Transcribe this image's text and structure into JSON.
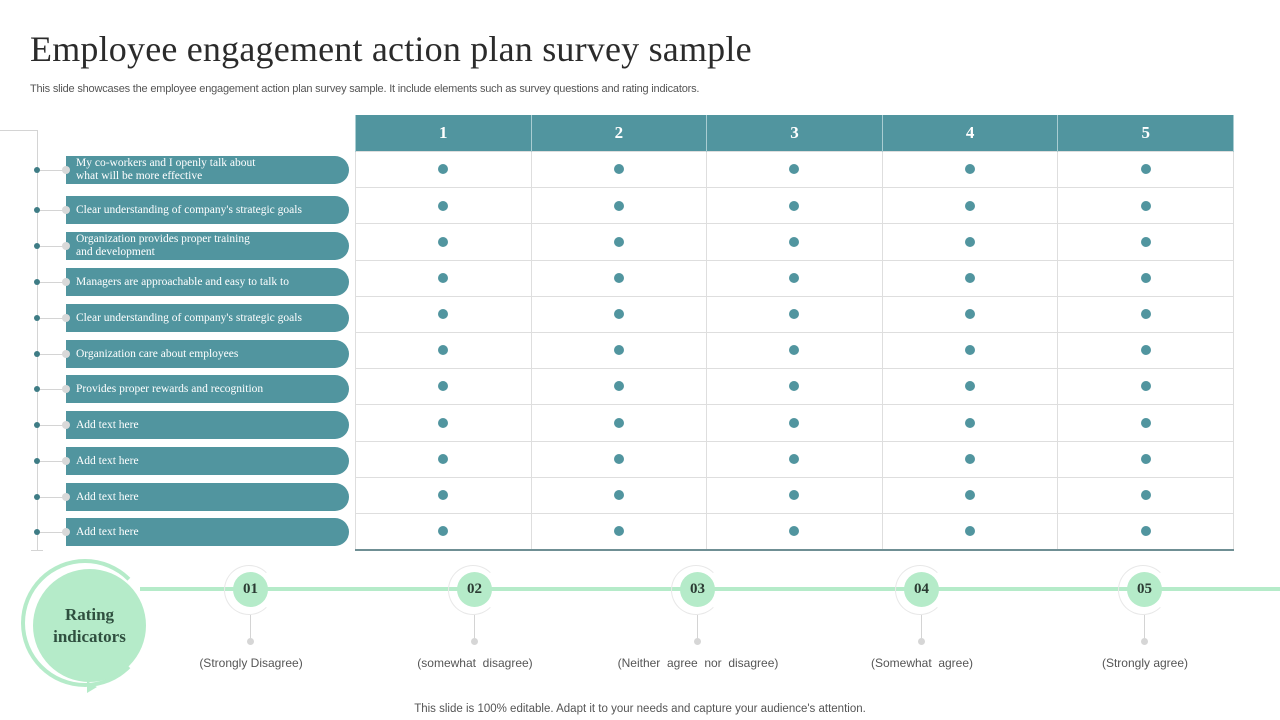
{
  "header": {
    "title": "Employee engagement action plan survey sample",
    "subtitle": "This slide showcases the employee engagement action plan survey sample. It include elements such as survey questions and rating indicators."
  },
  "colors": {
    "teal": "#51959f",
    "mint": "#b5ebc9"
  },
  "table": {
    "columns": [
      "1",
      "2",
      "3",
      "4",
      "5"
    ],
    "rows": [
      {
        "question": "My co-workers and I openly talk about what will be more effective"
      },
      {
        "question": "Clear understanding of company's strategic goals"
      },
      {
        "question": "Organization provides proper training and development"
      },
      {
        "question": "Managers are approachable and easy to talk to"
      },
      {
        "question": "Clear understanding of company's strategic goals"
      },
      {
        "question": "Organization care about employees"
      },
      {
        "question": "Provides proper rewards and recognition"
      },
      {
        "question": "Add text here"
      },
      {
        "question": "Add text here"
      },
      {
        "question": "Add text here"
      },
      {
        "question": "Add text here"
      }
    ]
  },
  "rating": {
    "title": "Rating indicators",
    "indicators": [
      {
        "number": "01",
        "label": "(Strongly Disagree)"
      },
      {
        "number": "02",
        "label": "(somewhat  disagree)"
      },
      {
        "number": "03",
        "label": "(Neither  agree  nor  disagree)"
      },
      {
        "number": "04",
        "label": "(Somewhat  agree)"
      },
      {
        "number": "05",
        "label": "(Strongly agree)"
      }
    ]
  },
  "footer": "This slide is 100% editable. Adapt it to your needs and capture your audience's attention."
}
